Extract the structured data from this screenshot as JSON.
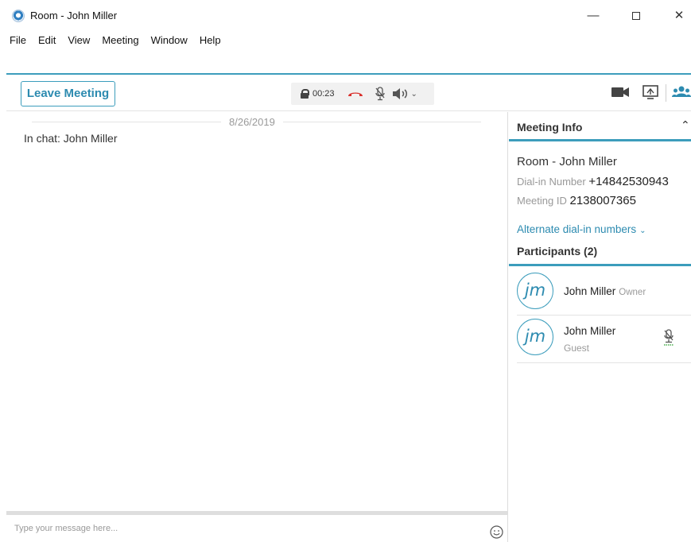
{
  "window": {
    "title": "Room - John Miller",
    "controls": {
      "minimize": "—",
      "close": "✕"
    }
  },
  "menu": [
    "File",
    "Edit",
    "View",
    "Meeting",
    "Window",
    "Help"
  ],
  "toolbar": {
    "leave_label": "Leave Meeting",
    "timer": "00:23",
    "icons": [
      "lock-icon",
      "hang-up-icon",
      "microphone-muted-icon",
      "speaker-icon",
      "video-icon",
      "screen-share-icon",
      "participants-icon"
    ]
  },
  "chat": {
    "date": "8/26/2019",
    "status": "In chat: John Miller",
    "input_placeholder": "Type your message here...",
    "input_value": ""
  },
  "meeting_info": {
    "header": "Meeting Info",
    "room_name": "Room - John Miller",
    "dialin_label": "Dial-in Number",
    "dialin_value": "+14842530943",
    "meeting_id_label": "Meeting ID",
    "meeting_id_value": "2138007365",
    "alt_dialin": "Alternate dial-in numbers"
  },
  "participants": {
    "header": "Participants (2)",
    "items": [
      {
        "initials": "jm",
        "name": "John Miller",
        "role": "Owner"
      },
      {
        "initials": "jm",
        "name": "John Miller",
        "role": "Guest"
      }
    ]
  },
  "colors": {
    "accent": "#3c9dbc",
    "accent_text": "#2d8bb0",
    "hangup": "#d9302c",
    "mic_green": "#4caf50"
  }
}
